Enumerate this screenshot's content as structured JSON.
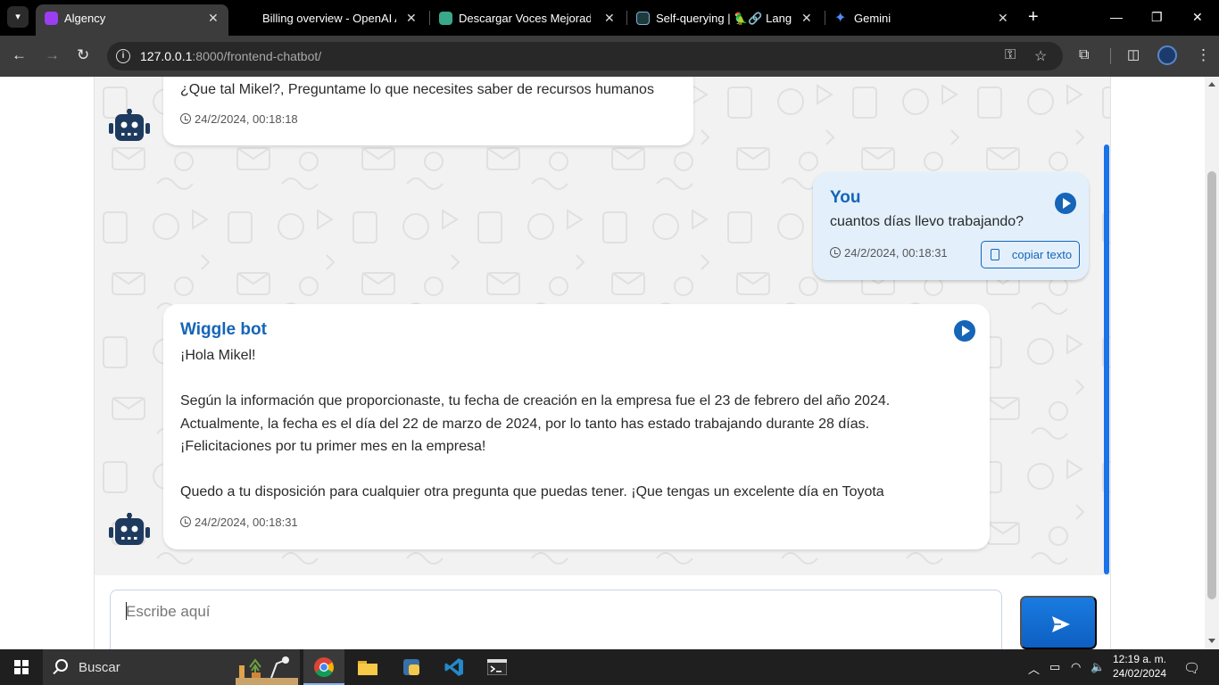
{
  "browser": {
    "tabs": [
      {
        "title": "Algency",
        "active": true,
        "favicon_color": "#9b3df0"
      },
      {
        "title": "Billing overview - OpenAI API",
        "active": false,
        "favicon_color": "#000000"
      },
      {
        "title": "Descargar Voces Mejoradas",
        "active": false,
        "favicon_color": "#3aa88a"
      },
      {
        "title": "Self-querying | 🦜🔗 Langchain",
        "active": false,
        "favicon_color": "#1c3c3c"
      },
      {
        "title": "Gemini",
        "active": false,
        "favicon_color": "#4f8df7"
      }
    ],
    "url_host": "127.0.0.1",
    "url_path": ":8000/frontend-chatbot/"
  },
  "chat": {
    "messages": [
      {
        "sender": "",
        "role": "bot",
        "text": "¿Que tal Mikel?, Preguntame lo que necesites saber de recursos humanos",
        "timestamp": "24/2/2024, 00:18:18"
      },
      {
        "sender": "You",
        "role": "user",
        "text": "cuantos días llevo trabajando?",
        "timestamp": "24/2/2024, 00:18:31",
        "copy_label": "copiar texto"
      },
      {
        "sender": "Wiggle bot",
        "role": "bot",
        "lines": [
          "¡Hola Mikel!",
          "",
          "Según la información que proporcionaste, tu fecha de creación en la empresa fue el 23 de febrero del año 2024.",
          "Actualmente, la fecha es el día del 22 de marzo de 2024, por lo tanto has estado trabajando durante 28 días.",
          "¡Felicitaciones por tu primer mes en la empresa!",
          "",
          "Quedo a tu disposición para cualquier otra pregunta que puedas tener. ¡Que tengas un excelente día en Toyota"
        ],
        "timestamp": "24/2/2024, 00:18:31"
      }
    ],
    "input_placeholder": "Escribe aquí"
  },
  "taskbar": {
    "search_placeholder": "Buscar",
    "time": "12:19 a. m.",
    "date": "24/02/2024"
  },
  "colors": {
    "accent": "#1565b8",
    "user_bubble": "#e3f0fc",
    "bot_avatar": "#1e3a5f"
  }
}
